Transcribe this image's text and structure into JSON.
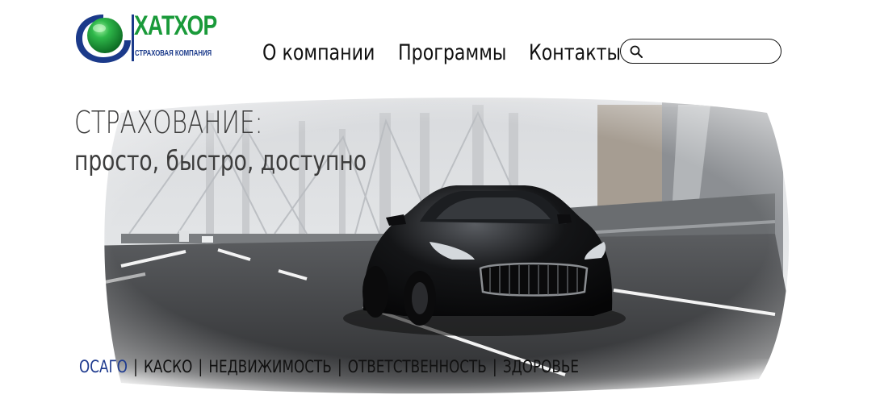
{
  "logo": {
    "title": "ХАТХОР",
    "subtitle": "СТРАХОВАЯ КОМПАНИЯ",
    "colors": {
      "green": "#1a9a3a",
      "blue": "#1b3a8a"
    }
  },
  "nav": {
    "items": [
      {
        "label": "О компании"
      },
      {
        "label": "Программы"
      },
      {
        "label": "Контакты"
      }
    ]
  },
  "search": {
    "icon": "search-icon",
    "value": "",
    "placeholder": ""
  },
  "hero": {
    "title": "СТРАХОВАНИЕ:",
    "subtitle": "просто, быстро, доступно"
  },
  "products": {
    "active_color": "#1f3b8f",
    "separator": "|",
    "items": [
      {
        "label": "ОСАГО",
        "active": true
      },
      {
        "label": "КАСКО",
        "active": false
      },
      {
        "label": "НЕДВИЖИМОСТЬ",
        "active": false
      },
      {
        "label": "ОТВЕТСТВЕННОСТЬ",
        "active": false
      },
      {
        "label": "ЗДОРОВЬЕ",
        "active": false
      }
    ]
  }
}
